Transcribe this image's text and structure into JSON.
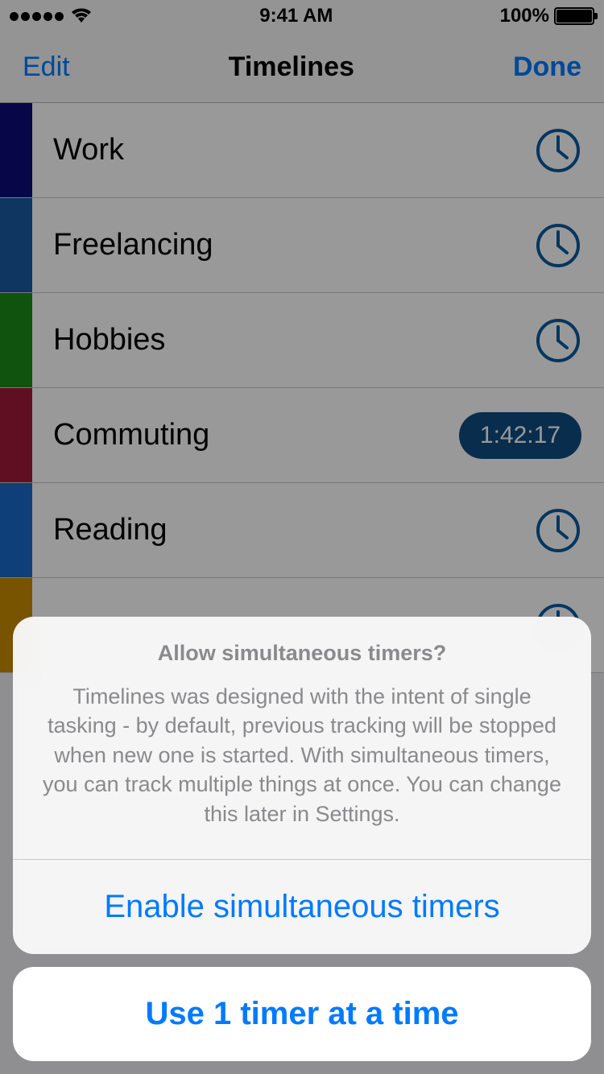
{
  "status": {
    "time": "9:41 AM",
    "battery_pct": "100%"
  },
  "nav": {
    "left": "Edit",
    "title": "Timelines",
    "right": "Done"
  },
  "rows": [
    {
      "label": "Work",
      "color": "#0a0a7a",
      "running_time": null
    },
    {
      "label": "Freelancing",
      "color": "#1a5aa0",
      "running_time": null
    },
    {
      "label": "Hobbies",
      "color": "#1a8a1a",
      "running_time": null
    },
    {
      "label": "Commuting",
      "color": "#a01a3a",
      "running_time": "1:42:17"
    },
    {
      "label": "Reading",
      "color": "#1a6ac8",
      "running_time": null
    },
    {
      "label": "",
      "color": "#c98a00",
      "running_time": null
    }
  ],
  "icon_color": "#0a5aa0",
  "sheet": {
    "title": "Allow simultaneous timers?",
    "message": "Timelines was designed with the intent of single tasking - by default, previous tracking will be stopped when new one is started. With simultaneous timers, you can track multiple things at once. You can change this later in Settings.",
    "action": "Enable simultaneous timers",
    "cancel": "Use 1 timer at a time"
  }
}
